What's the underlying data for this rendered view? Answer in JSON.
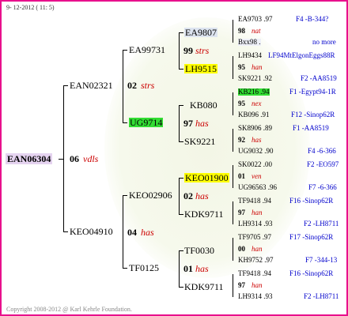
{
  "header": {
    "date": "9- 12-2012 ( 11: 5)"
  },
  "footer": {
    "copyright": "Copyright 2008-2012 @ Karl Kehrle Foundation."
  },
  "root": {
    "id": "EAN06304",
    "num": "06",
    "suffix": "vdls"
  },
  "gen1": [
    {
      "id": "EAN02321",
      "num": "02",
      "suffix": "strs"
    },
    {
      "id": "KEO04910",
      "num": "04",
      "suffix": "has"
    }
  ],
  "gen2": [
    {
      "id": "EA99731",
      "num": "99",
      "suffix": "strs"
    },
    {
      "id": "UG9714",
      "num": "97",
      "suffix": "has"
    },
    {
      "id": "KEO02906",
      "num": "02",
      "suffix": "has"
    },
    {
      "id": "TF0125",
      "num": "01",
      "suffix": "has"
    }
  ],
  "gen3": [
    {
      "id": "EA9807"
    },
    {
      "id": "LH9515"
    },
    {
      "id": "KB080"
    },
    {
      "id": "SK9221"
    },
    {
      "id": "KEO01900"
    },
    {
      "id": "KDK9711"
    },
    {
      "id": "TF0030"
    },
    {
      "id": "KDK9711"
    }
  ],
  "gen4": [
    {
      "top": "EA9703 .97",
      "topinfo": "F4 -B-344?",
      "mid_num": "98",
      "mid_suf": "nat",
      "bot": "Bxx98 .",
      "botinfo": "no more"
    },
    {
      "top": "LH9434",
      "topinfo": "LF94MtElgonEggs88R",
      "mid_num": "95",
      "mid_suf": "han",
      "bot": "SK9221 .92",
      "botinfo": "F2 -AA8519"
    },
    {
      "top": "KB216 .94",
      "topinfo": "F1 -Egypt94-1R",
      "mid_num": "95",
      "mid_suf": "nex",
      "bot": "KB096 .91",
      "botinfo": "F12 -Sinop62R"
    },
    {
      "top": "SK8906 .89",
      "topinfo": "F1 -AA8519",
      "mid_num": "92",
      "mid_suf": "has",
      "bot": "UG9032 .90",
      "botinfo": "F4 -6-366"
    },
    {
      "top": "SK0022 .00",
      "topinfo": "F2 -EO597",
      "mid_num": "01",
      "mid_suf": "ven",
      "bot": "UG96563 .96",
      "botinfo": "F7 -6-366"
    },
    {
      "top": "TF9418 .94",
      "topinfo": "F16 -Sinop62R",
      "mid_num": "97",
      "mid_suf": "han",
      "bot": "LH9314 .93",
      "botinfo": "F2 -LH8711"
    },
    {
      "top": "TF9705 .97",
      "topinfo": "F17 -Sinop62R",
      "mid_num": "00",
      "mid_suf": "han",
      "bot": "KH9752 .97",
      "botinfo": "F7 -344-13"
    },
    {
      "top": "TF9418 .94",
      "topinfo": "F16 -Sinop62R",
      "mid_num": "97",
      "mid_suf": "han",
      "bot": "LH9314 .93",
      "botinfo": "F2 -LH8711"
    }
  ]
}
